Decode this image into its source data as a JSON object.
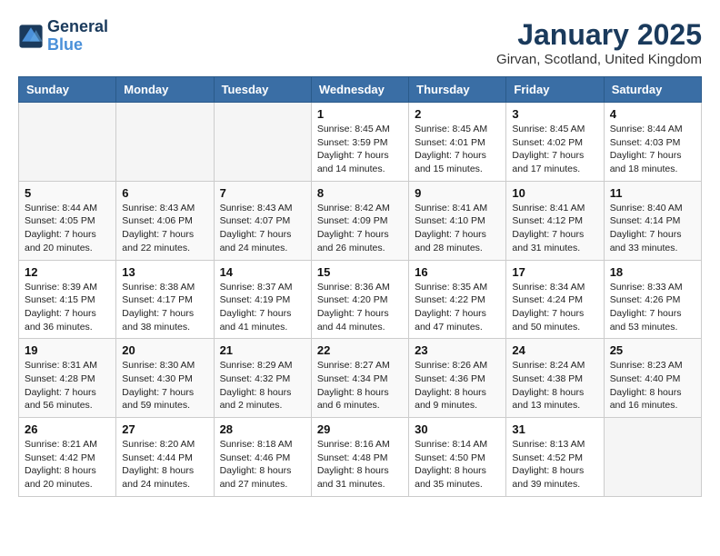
{
  "logo": {
    "line1": "General",
    "line2": "Blue"
  },
  "title": "January 2025",
  "subtitle": "Girvan, Scotland, United Kingdom",
  "weekdays": [
    "Sunday",
    "Monday",
    "Tuesday",
    "Wednesday",
    "Thursday",
    "Friday",
    "Saturday"
  ],
  "weeks": [
    [
      {
        "day": "",
        "info": ""
      },
      {
        "day": "",
        "info": ""
      },
      {
        "day": "",
        "info": ""
      },
      {
        "day": "1",
        "info": "Sunrise: 8:45 AM\nSunset: 3:59 PM\nDaylight: 7 hours\nand 14 minutes."
      },
      {
        "day": "2",
        "info": "Sunrise: 8:45 AM\nSunset: 4:01 PM\nDaylight: 7 hours\nand 15 minutes."
      },
      {
        "day": "3",
        "info": "Sunrise: 8:45 AM\nSunset: 4:02 PM\nDaylight: 7 hours\nand 17 minutes."
      },
      {
        "day": "4",
        "info": "Sunrise: 8:44 AM\nSunset: 4:03 PM\nDaylight: 7 hours\nand 18 minutes."
      }
    ],
    [
      {
        "day": "5",
        "info": "Sunrise: 8:44 AM\nSunset: 4:05 PM\nDaylight: 7 hours\nand 20 minutes."
      },
      {
        "day": "6",
        "info": "Sunrise: 8:43 AM\nSunset: 4:06 PM\nDaylight: 7 hours\nand 22 minutes."
      },
      {
        "day": "7",
        "info": "Sunrise: 8:43 AM\nSunset: 4:07 PM\nDaylight: 7 hours\nand 24 minutes."
      },
      {
        "day": "8",
        "info": "Sunrise: 8:42 AM\nSunset: 4:09 PM\nDaylight: 7 hours\nand 26 minutes."
      },
      {
        "day": "9",
        "info": "Sunrise: 8:41 AM\nSunset: 4:10 PM\nDaylight: 7 hours\nand 28 minutes."
      },
      {
        "day": "10",
        "info": "Sunrise: 8:41 AM\nSunset: 4:12 PM\nDaylight: 7 hours\nand 31 minutes."
      },
      {
        "day": "11",
        "info": "Sunrise: 8:40 AM\nSunset: 4:14 PM\nDaylight: 7 hours\nand 33 minutes."
      }
    ],
    [
      {
        "day": "12",
        "info": "Sunrise: 8:39 AM\nSunset: 4:15 PM\nDaylight: 7 hours\nand 36 minutes."
      },
      {
        "day": "13",
        "info": "Sunrise: 8:38 AM\nSunset: 4:17 PM\nDaylight: 7 hours\nand 38 minutes."
      },
      {
        "day": "14",
        "info": "Sunrise: 8:37 AM\nSunset: 4:19 PM\nDaylight: 7 hours\nand 41 minutes."
      },
      {
        "day": "15",
        "info": "Sunrise: 8:36 AM\nSunset: 4:20 PM\nDaylight: 7 hours\nand 44 minutes."
      },
      {
        "day": "16",
        "info": "Sunrise: 8:35 AM\nSunset: 4:22 PM\nDaylight: 7 hours\nand 47 minutes."
      },
      {
        "day": "17",
        "info": "Sunrise: 8:34 AM\nSunset: 4:24 PM\nDaylight: 7 hours\nand 50 minutes."
      },
      {
        "day": "18",
        "info": "Sunrise: 8:33 AM\nSunset: 4:26 PM\nDaylight: 7 hours\nand 53 minutes."
      }
    ],
    [
      {
        "day": "19",
        "info": "Sunrise: 8:31 AM\nSunset: 4:28 PM\nDaylight: 7 hours\nand 56 minutes."
      },
      {
        "day": "20",
        "info": "Sunrise: 8:30 AM\nSunset: 4:30 PM\nDaylight: 7 hours\nand 59 minutes."
      },
      {
        "day": "21",
        "info": "Sunrise: 8:29 AM\nSunset: 4:32 PM\nDaylight: 8 hours\nand 2 minutes."
      },
      {
        "day": "22",
        "info": "Sunrise: 8:27 AM\nSunset: 4:34 PM\nDaylight: 8 hours\nand 6 minutes."
      },
      {
        "day": "23",
        "info": "Sunrise: 8:26 AM\nSunset: 4:36 PM\nDaylight: 8 hours\nand 9 minutes."
      },
      {
        "day": "24",
        "info": "Sunrise: 8:24 AM\nSunset: 4:38 PM\nDaylight: 8 hours\nand 13 minutes."
      },
      {
        "day": "25",
        "info": "Sunrise: 8:23 AM\nSunset: 4:40 PM\nDaylight: 8 hours\nand 16 minutes."
      }
    ],
    [
      {
        "day": "26",
        "info": "Sunrise: 8:21 AM\nSunset: 4:42 PM\nDaylight: 8 hours\nand 20 minutes."
      },
      {
        "day": "27",
        "info": "Sunrise: 8:20 AM\nSunset: 4:44 PM\nDaylight: 8 hours\nand 24 minutes."
      },
      {
        "day": "28",
        "info": "Sunrise: 8:18 AM\nSunset: 4:46 PM\nDaylight: 8 hours\nand 27 minutes."
      },
      {
        "day": "29",
        "info": "Sunrise: 8:16 AM\nSunset: 4:48 PM\nDaylight: 8 hours\nand 31 minutes."
      },
      {
        "day": "30",
        "info": "Sunrise: 8:14 AM\nSunset: 4:50 PM\nDaylight: 8 hours\nand 35 minutes."
      },
      {
        "day": "31",
        "info": "Sunrise: 8:13 AM\nSunset: 4:52 PM\nDaylight: 8 hours\nand 39 minutes."
      },
      {
        "day": "",
        "info": ""
      }
    ]
  ]
}
